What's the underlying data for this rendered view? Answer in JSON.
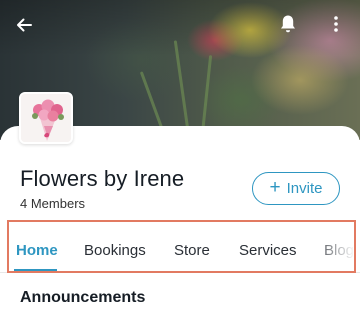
{
  "header": {
    "back_icon": "arrow-left-icon",
    "notifications_icon": "bell-icon",
    "more_icon": "more-vertical-icon"
  },
  "group": {
    "name": "Flowers by Irene",
    "members": "4 Members",
    "avatar_icon": "flower-bouquet-image"
  },
  "invite_button": {
    "icon": "plus-icon",
    "plus": "+",
    "label": "Invite"
  },
  "tabs": [
    {
      "label": "Home",
      "active": true
    },
    {
      "label": "Bookings",
      "active": false
    },
    {
      "label": "Store",
      "active": false
    },
    {
      "label": "Services",
      "active": false
    },
    {
      "label": "Blog",
      "active": false
    }
  ],
  "announcements": {
    "title": "Announcements"
  },
  "colors": {
    "accent": "#2e96c1",
    "highlight_outline": "#e27a61",
    "text_primary": "#161d25"
  }
}
